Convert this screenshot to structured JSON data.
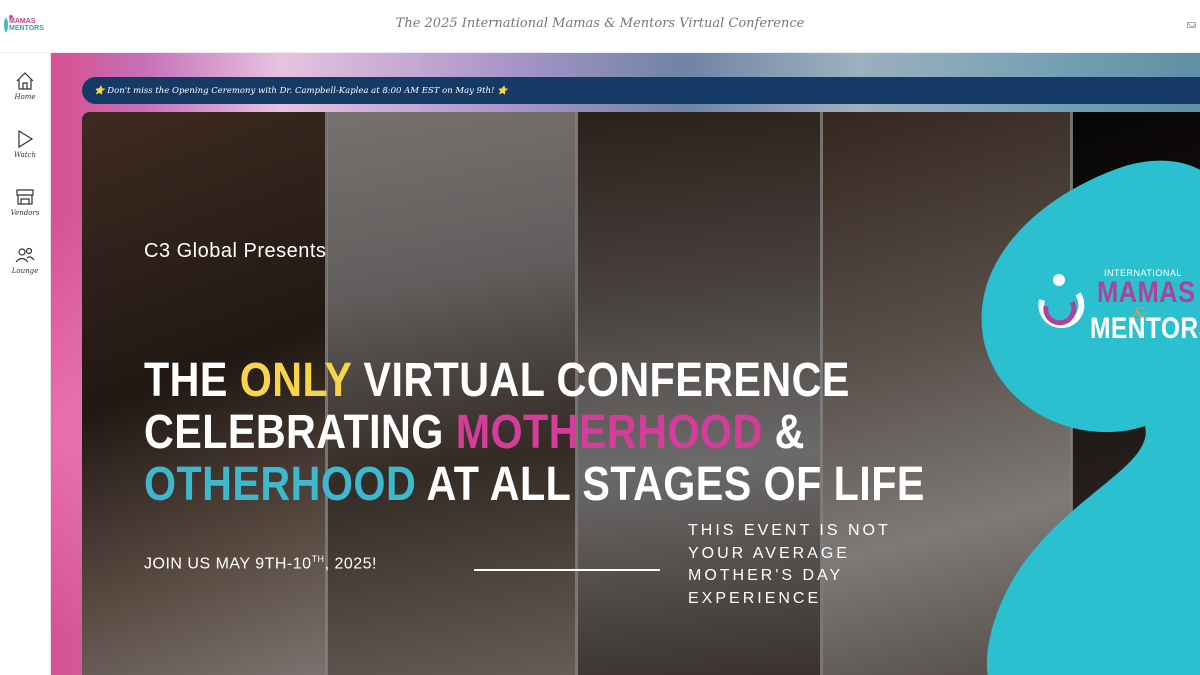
{
  "header": {
    "logo": {
      "line1": "MAMAS",
      "line2": "MENTORS"
    },
    "title": "The 2025 International Mamas & Mentors Virtual Conference",
    "mail_icon": "mail-icon"
  },
  "sidebar": {
    "items": [
      {
        "label": "Home",
        "icon": "home-icon"
      },
      {
        "label": "Watch",
        "icon": "play-icon"
      },
      {
        "label": "Vendors",
        "icon": "store-icon"
      },
      {
        "label": "Lounge",
        "icon": "people-icon"
      }
    ]
  },
  "announcement": {
    "text": "⭐ Don't miss the Opening Ceremony with Dr. Campbell-Kaplea at 8:00 AM EST on May 9th! ⭐"
  },
  "hero": {
    "presents": "C3 Global Presents",
    "headline": {
      "l1_a": "THE ",
      "l1_b": "ONLY",
      "l1_c": " VIRTUAL CONFERENCE",
      "l2_a": "CELEBRATING ",
      "l2_b": "MOTHERHOOD",
      "l2_c": " &",
      "l3_a": "OTHERHOOD",
      "l3_b": " AT ALL STAGES OF LIFE"
    },
    "join": {
      "a": "JOIN US MAY 9TH-10",
      "sup": "TH",
      "b": ", 2025!"
    },
    "tagline": [
      "THIS EVENT IS NOT",
      "YOUR AVERAGE",
      "MOTHER'S DAY",
      "EXPERIENCE"
    ],
    "badge": {
      "international": "INTERNATIONAL",
      "mamas": "MAMAS",
      "amp": "&",
      "mentors": "MENTORS"
    }
  },
  "colors": {
    "banner_bg": "#153a66",
    "yellow": "#f6d54a",
    "pink": "#d43e9a",
    "teal": "#3db8cc",
    "blob": "#2bc0cf"
  }
}
